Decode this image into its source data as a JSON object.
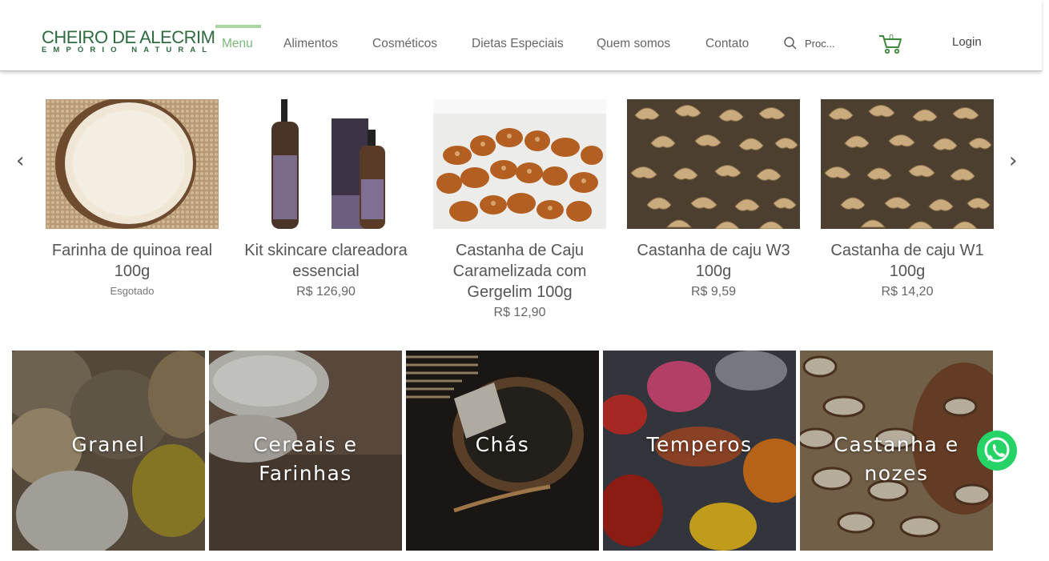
{
  "brand": {
    "name": "CHEIRO DE ALECRIM",
    "tagline": "EMPÓRIO NATURAL",
    "color": "#2e6b3f"
  },
  "nav": {
    "items": [
      {
        "label": "Menu",
        "active": true
      },
      {
        "label": "Alimentos"
      },
      {
        "label": "Cosméticos"
      },
      {
        "label": "Dietas Especiais"
      },
      {
        "label": "Quem somos"
      },
      {
        "label": "Contato"
      }
    ],
    "active_color": "#7cb87a"
  },
  "search": {
    "placeholder": "Proc...",
    "icon": "search-icon"
  },
  "cart": {
    "count": "0",
    "icon": "cart-icon",
    "color": "#3d8a3d"
  },
  "login": {
    "label": "Login"
  },
  "slider": {
    "prev_icon": "‹",
    "next_icon": "›",
    "products": [
      {
        "name": "Farinha de quinoa real 100g",
        "status": "Esgotado",
        "price": ""
      },
      {
        "name": "Kit skincare clareadora essencial",
        "price": "R$ 126,90"
      },
      {
        "name": "Castanha de Caju Caramelizada com Gergelim 100g",
        "price": "R$ 12,90"
      },
      {
        "name": "Castanha de caju W3 100g",
        "price": "R$ 9,59"
      },
      {
        "name": "Castanha de caju W1 100g",
        "price": "R$ 14,20"
      }
    ]
  },
  "categories": [
    {
      "label": "Granel"
    },
    {
      "label": "Cereais e Farinhas"
    },
    {
      "label": "Chás"
    },
    {
      "label": "Temperos"
    },
    {
      "label": "Castanha e nozes"
    }
  ],
  "whatsapp": {
    "icon": "whatsapp-icon",
    "color": "#25d366"
  }
}
